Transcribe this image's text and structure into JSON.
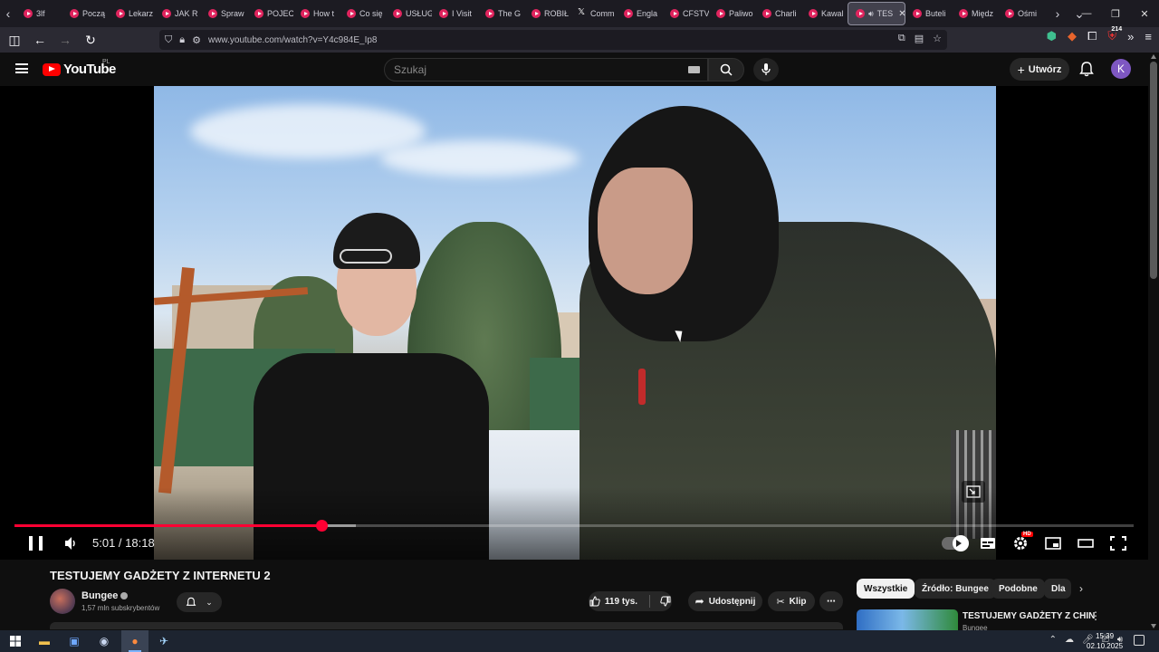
{
  "browser": {
    "tabs": [
      {
        "label": "3lf"
      },
      {
        "label": "Począ"
      },
      {
        "label": "Lekarz"
      },
      {
        "label": "JAK R"
      },
      {
        "label": "Spraw"
      },
      {
        "label": "POJEC"
      },
      {
        "label": "How t"
      },
      {
        "label": "Co się"
      },
      {
        "label": "USŁUG"
      },
      {
        "label": "I Visit"
      },
      {
        "label": "The G"
      },
      {
        "label": "ROBIŁ"
      },
      {
        "label": "Comm",
        "icon": "x-icon"
      },
      {
        "label": "Engla"
      },
      {
        "label": "CFSTV"
      },
      {
        "label": "Paliwo"
      },
      {
        "label": "Charli"
      },
      {
        "label": "Kawal"
      }
    ],
    "active_tab": {
      "label": "TES",
      "audio": "speaker-icon"
    },
    "tabs_after": [
      {
        "label": "Buteli"
      },
      {
        "label": "Międz"
      },
      {
        "label": "Ośmi"
      }
    ],
    "url": "www.youtube.com/watch?v=Y4c984E_Ip8",
    "extension_badge": "214"
  },
  "youtube": {
    "logo_text": "YouTube",
    "country_code": "PL",
    "search_placeholder": "Szukaj",
    "create_label": "Utwórz",
    "avatar_letter": "K"
  },
  "player": {
    "current_time": "5:01",
    "separator": " / ",
    "duration": "18:18",
    "played_fraction": 0.274,
    "buffered_fraction": 0.305,
    "hd_badge": "HD"
  },
  "video": {
    "title": "TESTUJEMY GADŻETY Z INTERNETU 2",
    "channel": "Bungee",
    "subscribers": "1,57 mln subskrybentów",
    "likes": "119 tys.",
    "share_label": "Udostępnij",
    "clip_label": "Klip"
  },
  "filter_chips": [
    "Wszystkie",
    "Źródło: Bungee",
    "Podobne",
    "Dla"
  ],
  "recommendation": {
    "title": "TESTUJEMY GADŻETY Z CHIN",
    "channel": "Bungee"
  },
  "taskbar": {
    "time": "15:39",
    "date": "02.10.2025"
  },
  "colors": {
    "accent_red": "#ff0033",
    "youtube_red": "#ff0000",
    "background": "#0f0f0f"
  }
}
